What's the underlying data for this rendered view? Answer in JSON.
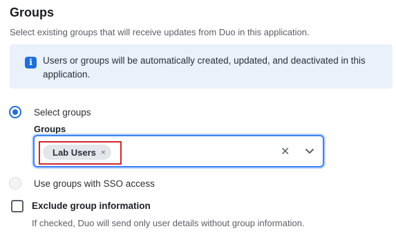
{
  "section": {
    "title": "Groups",
    "subtitle": "Select existing groups that will receive updates from Duo in this application."
  },
  "info_banner": {
    "icon": "info-icon",
    "icon_glyph": "i",
    "text": "Users or groups will be automatically created, updated, and deactivated in this application."
  },
  "options": {
    "select_groups": {
      "label": "Select groups",
      "selected": true
    },
    "groups_field": {
      "label": "Groups",
      "tags": [
        {
          "label": "Lab Users",
          "remove_glyph": "×"
        }
      ],
      "clear_glyph": "✕"
    },
    "sso_groups": {
      "label": "Use groups with SSO access",
      "selected": false
    }
  },
  "exclude": {
    "label": "Exclude group information",
    "checked": false,
    "help": "If checked, Duo will send only user details without group information."
  },
  "colors": {
    "accent": "#1f6fd6",
    "focus_border": "#3b82f6",
    "highlight": "#d0262f",
    "info_bg": "#eaf1fb"
  }
}
